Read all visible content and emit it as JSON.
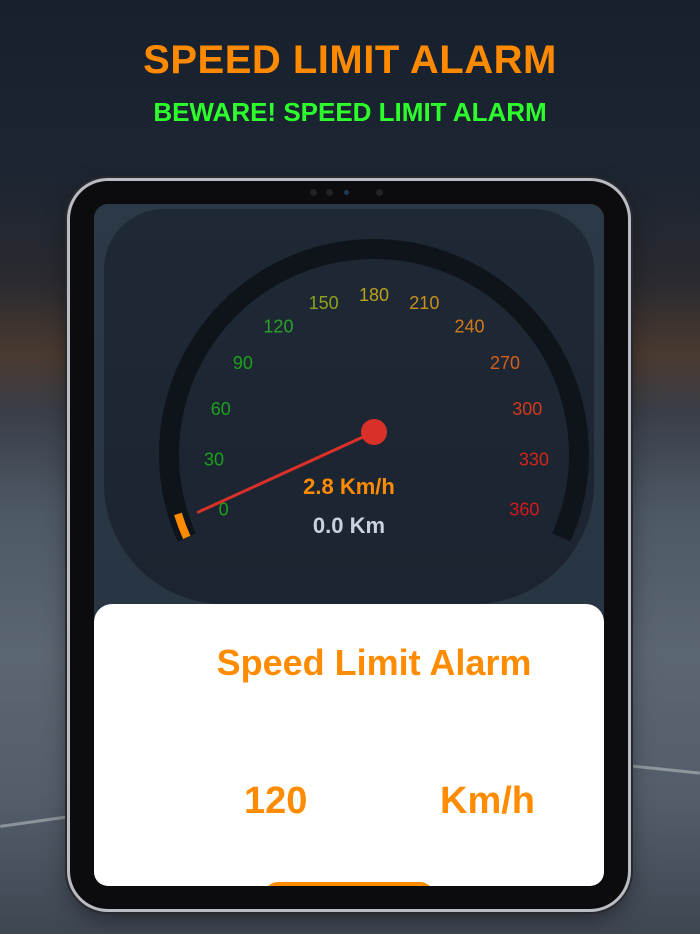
{
  "header": {
    "title": "SPEED LIMIT ALARM",
    "subtitle": "BEWARE! SPEED LIMIT ALARM"
  },
  "speedometer": {
    "ticks": [
      "0",
      "30",
      "60",
      "90",
      "120",
      "150",
      "180",
      "210",
      "240",
      "270",
      "300",
      "330",
      "360"
    ],
    "tick_colors": [
      "#1aa21a",
      "#1aa21a",
      "#1aa21a",
      "#1aa21a",
      "#2aa22a",
      "#8fa21a",
      "#b9a21a",
      "#c7901a",
      "#d27a1a",
      "#d2601a",
      "#d23a1a",
      "#d2251a",
      "#d21a1a"
    ],
    "current_speed": "2.8 Km/h",
    "speed_value": 2.8,
    "speed_max": 360,
    "distance": "0.0 Km",
    "needle_color": "#d9302a",
    "speed_text_color": "#ff8c00",
    "arc_color": "#0f141a",
    "progress_color": "#ff8c00"
  },
  "alarm_sheet": {
    "title": "Speed Limit Alarm",
    "limit_value": "120",
    "limit_unit": "Km/h"
  },
  "colors": {
    "accent": "#ff8c00",
    "subtitle": "#2dff2d"
  }
}
